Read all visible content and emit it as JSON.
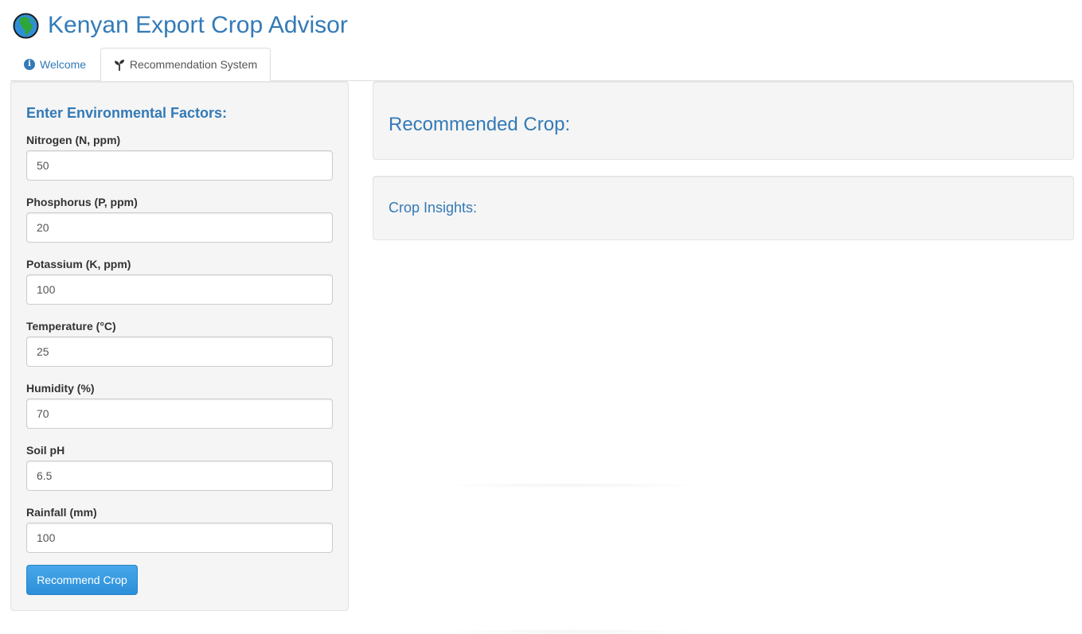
{
  "app": {
    "title": "Kenyan Export Crop Advisor",
    "logo_icon": "globe-icon"
  },
  "tabs": [
    {
      "label": "Welcome",
      "icon": "info-circle-icon",
      "active": false
    },
    {
      "label": "Recommendation System",
      "icon": "seedling-icon",
      "active": true
    }
  ],
  "sidebar": {
    "heading": "Enter Environmental Factors:",
    "fields": [
      {
        "label": "Nitrogen (N, ppm)",
        "value": "50"
      },
      {
        "label": "Phosphorus (P, ppm)",
        "value": "20"
      },
      {
        "label": "Potassium (K, ppm)",
        "value": "100"
      },
      {
        "label": "Temperature (°C)",
        "value": "25"
      },
      {
        "label": "Humidity (%)",
        "value": "70"
      },
      {
        "label": "Soil pH",
        "value": "6.5"
      },
      {
        "label": "Rainfall (mm)",
        "value": "100"
      }
    ],
    "button_label": "Recommend Crop"
  },
  "main": {
    "recommended_heading": "Recommended Crop:",
    "insights_heading": "Crop Insights:"
  },
  "colors": {
    "accent": "#337ab7",
    "button": "#2b8fd8",
    "well_background": "#f5f5f5"
  }
}
